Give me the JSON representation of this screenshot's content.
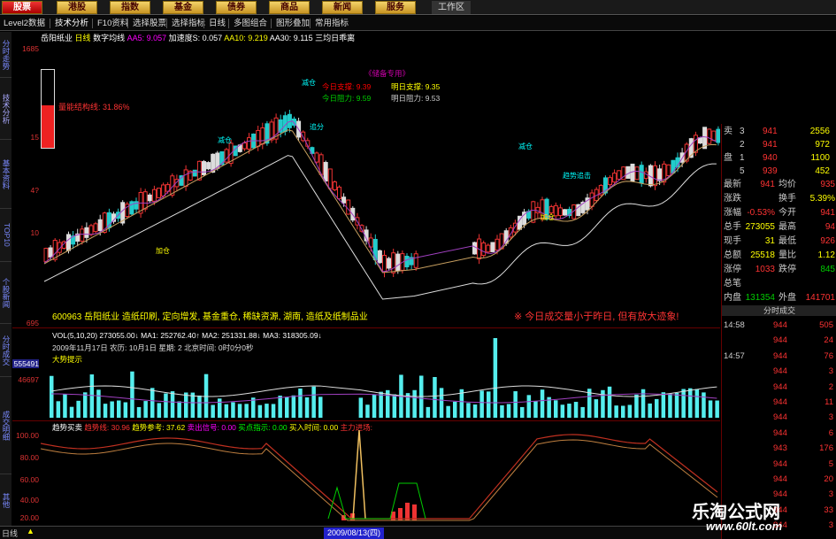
{
  "top_menu": {
    "items": [
      "股票",
      "港股",
      "指数",
      "基金",
      "债券",
      "商品",
      "新闻",
      "服务"
    ],
    "active_index": 0,
    "workarea": "工作区"
  },
  "tab_row": {
    "items": [
      "Level2数据",
      "技术分析",
      "F10资料",
      "选择股票",
      "选择指标",
      "日线",
      "多图组合",
      "图形叠加",
      "常用指标"
    ]
  },
  "side_tabs": [
    "分时走势",
    "技术分析",
    "基本资料",
    "TOP10",
    "个股新闻",
    "分时成交",
    "成交明细",
    "其他"
  ],
  "info_bar": {
    "name": "岳阳纸业",
    "period": "日线",
    "ma_label": "数字均线",
    "items": [
      "AA5: 9.057",
      "加速度S: 0.057",
      "AA10: 9.219",
      "AA30: 9.115",
      "三均日乖离"
    ]
  },
  "price_axis": [
    "1685",
    "15",
    "4?",
    "10",
    "695"
  ],
  "gauge": {
    "label": "量能结构线: 31.86%",
    "level": 0.55
  },
  "support_box": {
    "title": "《储备专用》",
    "today_support_label": "今日支撑: 9.39",
    "tomorrow_support_label": "明日支撑: 9.35",
    "today_resist_label": "今日阻力: 9.59",
    "tomorrow_resist_label": "明日阻力: 9.53"
  },
  "annotations": [
    "减仓",
    "减仓",
    "加仓",
    "追分",
    "减仓",
    "趋势追击",
    "加仓"
  ],
  "stock_info": "600963 岳阳纸业 造纸印刷, 定向增发, 基金重仓, 稀缺资源, 湖南, 造纸及纸制品业",
  "warning": "※ 今日成交量小于昨日, 但有放大迹象!",
  "volume_bar": {
    "line1": "VOL(5,10,20) 273055.00↓ MA1: 252762.40↑ MA2: 251331.88↓ MA3: 318305.09↓",
    "line2": "2009年11月17日 农历: 10月1日 星期: 2 北京时间: 0时0分0秒",
    "line3": "大势提示",
    "axis": [
      "555491",
      "46697",
      "0"
    ]
  },
  "indicator": {
    "name": "趋势买卖",
    "items": [
      "趋势线: 30.96",
      "趋势参考: 37.62",
      "卖出信号: 0.00",
      "买点指示: 0.00",
      "买入时间: 0.00",
      "主力进场:"
    ],
    "axis": [
      "100.00",
      "80.00",
      "60.00",
      "40.00",
      "20.00"
    ]
  },
  "right_panel": {
    "order_book": [
      {
        "label": "卖",
        "level": "3",
        "price": "941",
        "vol": "2556"
      },
      {
        "label": "",
        "level": "2",
        "price": "941",
        "vol": "972"
      },
      {
        "label": "盘",
        "level": "1",
        "price": "940",
        "vol": "1100"
      },
      {
        "label": "",
        "level": "5",
        "price": "939",
        "vol": "452"
      }
    ],
    "quotes": [
      {
        "l1": "最新",
        "v1": "941",
        "l2": "均价",
        "v2": "935"
      },
      {
        "l1": "涨跌",
        "v1": "",
        "l2": "换手",
        "v2": "5.39%"
      },
      {
        "l1": "涨幅",
        "v1": "-0.53%",
        "l2": "今开",
        "v2": "941"
      },
      {
        "l1": "总手",
        "v1": "273055",
        "l2": "最高",
        "v2": "94"
      },
      {
        "l1": "现手",
        "v1": "31",
        "l2": "最低",
        "v2": "926"
      },
      {
        "l1": "总额",
        "v1": "25518",
        "l2": "量比",
        "v2": "1.12"
      },
      {
        "l1": "涨停",
        "v1": "1033",
        "l2": "跌停",
        "v2": "845"
      },
      {
        "l1": "总笔",
        "v1": "",
        "l2": "",
        "v2": ""
      },
      {
        "l1": "内盘",
        "v1": "131354",
        "l2": "外盘",
        "v2": "141701"
      }
    ],
    "trade_header": "分时成交",
    "trades": [
      {
        "time": "14:58",
        "price": "944",
        "vol": "505"
      },
      {
        "time": "",
        "price": "944",
        "vol": "24"
      },
      {
        "time": "14:57",
        "price": "944",
        "vol": "76"
      },
      {
        "time": "",
        "price": "944",
        "vol": "3"
      },
      {
        "time": "",
        "price": "944",
        "vol": "2"
      },
      {
        "time": "",
        "price": "944",
        "vol": "11"
      },
      {
        "time": "",
        "price": "944",
        "vol": "3"
      },
      {
        "time": "",
        "price": "944",
        "vol": "6"
      },
      {
        "time": "",
        "price": "943",
        "vol": "176"
      },
      {
        "time": "",
        "price": "944",
        "vol": "5"
      },
      {
        "time": "",
        "price": "944",
        "vol": "20"
      },
      {
        "time": "",
        "price": "944",
        "vol": "3"
      },
      {
        "time": "",
        "price": "944",
        "vol": "33"
      },
      {
        "time": "",
        "price": "944",
        "vol": "3"
      }
    ]
  },
  "bottom_bar": {
    "period": "日线",
    "date": "2009/08/13(四)"
  },
  "watermark": {
    "name": "乐淘公式网",
    "url": "www.60lt.com"
  }
}
